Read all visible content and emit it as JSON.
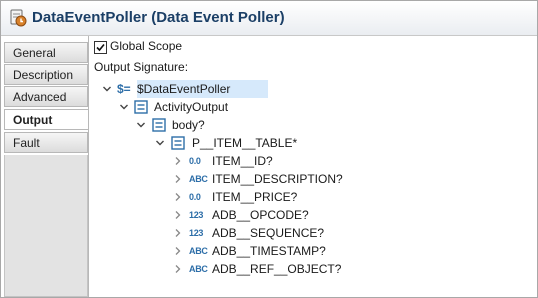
{
  "header": {
    "title": "DataEventPoller (Data Event Poller)",
    "icon": "event-poller-icon"
  },
  "tabs": [
    {
      "label": "General",
      "active": false
    },
    {
      "label": "Description",
      "active": false
    },
    {
      "label": "Advanced",
      "active": false
    },
    {
      "label": "Output",
      "active": true
    },
    {
      "label": "Fault",
      "active": false
    }
  ],
  "output": {
    "global_scope_label": "Global Scope",
    "global_scope_checked": true,
    "signature_label": "Output Signature:"
  },
  "tree": {
    "root": {
      "prefix": "$=",
      "label": "$DataEventPoller"
    },
    "activity_output": "ActivityOutput",
    "body": "body?",
    "table": "P__ITEM__TABLE*",
    "fields": [
      {
        "type_icon": "0.0",
        "label": "ITEM__ID?"
      },
      {
        "type_icon": "ABC",
        "label": "ITEM__DESCRIPTION?"
      },
      {
        "type_icon": "0.0",
        "label": "ITEM__PRICE?"
      },
      {
        "type_icon": "123",
        "label": "ADB__OPCODE?"
      },
      {
        "type_icon": "123",
        "label": "ADB__SEQUENCE?"
      },
      {
        "type_icon": "ABC",
        "label": "ADB__TIMESTAMP?"
      },
      {
        "type_icon": "ABC",
        "label": "ADB__REF__OBJECT?"
      }
    ]
  },
  "colors": {
    "title": "#1b3f66",
    "type_icon": "#2d6ea8",
    "node_icon": "#2d6ea8",
    "selection": "#d6e9fb"
  }
}
